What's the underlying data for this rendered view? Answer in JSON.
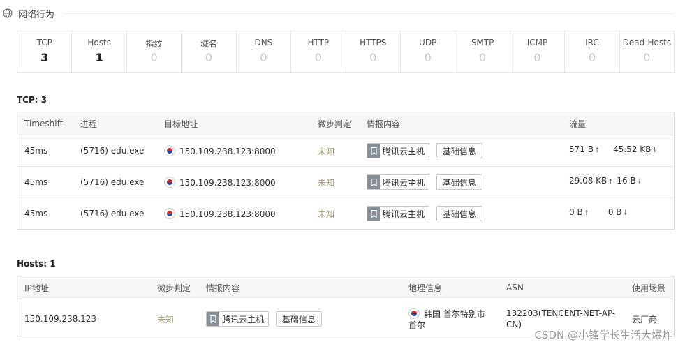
{
  "header": {
    "title": "网络行为",
    "icon": "globe-icon"
  },
  "stats": [
    {
      "label": "TCP",
      "value": "3"
    },
    {
      "label": "Hosts",
      "value": "1"
    },
    {
      "label": "指纹",
      "value": "0"
    },
    {
      "label": "域名",
      "value": "0"
    },
    {
      "label": "DNS",
      "value": "0"
    },
    {
      "label": "HTTP",
      "value": "0"
    },
    {
      "label": "HTTPS",
      "value": "0"
    },
    {
      "label": "UDP",
      "value": "0"
    },
    {
      "label": "SMTP",
      "value": "0"
    },
    {
      "label": "ICMP",
      "value": "0"
    },
    {
      "label": "IRC",
      "value": "0"
    },
    {
      "label": "Dead-Hosts",
      "value": "0"
    }
  ],
  "tcp": {
    "title": "TCP: 3",
    "columns": [
      "Timeshift",
      "进程",
      "目标地址",
      "微步判定",
      "情报内容",
      "流量"
    ],
    "rows": [
      {
        "timeshift": "45ms",
        "process": "(5716) edu.exe",
        "target": "150.109.238.123:8000",
        "verdict": "未知",
        "intel": "腾讯云主机",
        "basic": "基础信息",
        "up": "571 B",
        "down": "45.52 KB"
      },
      {
        "timeshift": "45ms",
        "process": "(5716) edu.exe",
        "target": "150.109.238.123:8000",
        "verdict": "未知",
        "intel": "腾讯云主机",
        "basic": "基础信息",
        "up": "29.08 KB",
        "down": "16 B"
      },
      {
        "timeshift": "45ms",
        "process": "(5716) edu.exe",
        "target": "150.109.238.123:8000",
        "verdict": "未知",
        "intel": "腾讯云主机",
        "basic": "基础信息",
        "up": "0 B",
        "down": "0 B"
      }
    ]
  },
  "hosts": {
    "title": "Hosts: 1",
    "columns": [
      "IP地址",
      "微步判定",
      "情报内容",
      "地理信息",
      "ASN",
      "使用场景"
    ],
    "rows": [
      {
        "ip": "150.109.238.123",
        "verdict": "未知",
        "intel": "腾讯云主机",
        "basic": "基础信息",
        "geo_line1": "韩国 首尔特别市",
        "geo_line2": "首尔",
        "asn_line1": "132203(TENCENT-NET-AP-",
        "asn_line2": "CN)",
        "scene": "云厂商"
      }
    ]
  },
  "watermark": "CSDN @小锋学长生活大爆炸",
  "colors": {
    "unknown": "#a6a07a",
    "header_bg": "#f5f6f8",
    "border": "#e0e0e0"
  }
}
